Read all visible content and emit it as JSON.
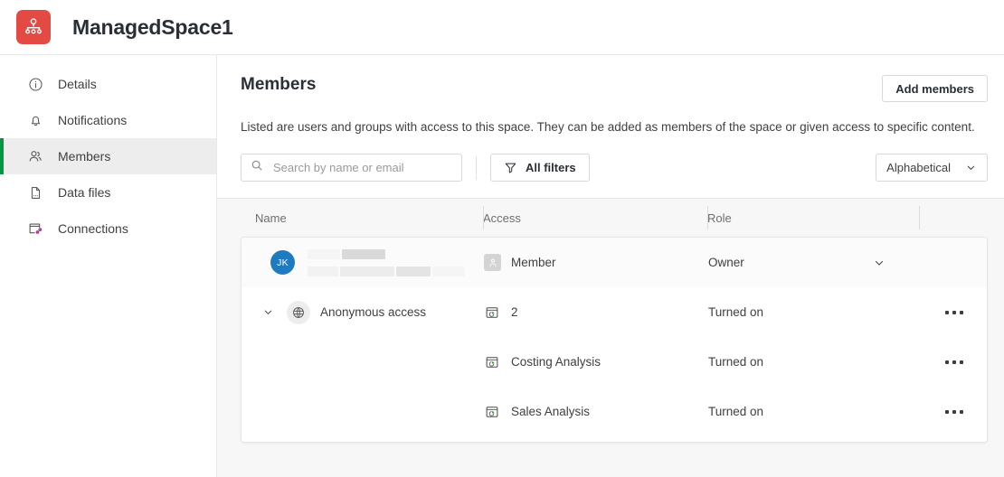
{
  "header": {
    "space_name": "ManagedSpace1",
    "space_icon": "shared-space-icon",
    "icon_color": "#e24a43"
  },
  "sidebar": {
    "items": [
      {
        "label": "Details",
        "icon": "info-circle-icon",
        "active": false
      },
      {
        "label": "Notifications",
        "icon": "bell-icon",
        "active": false
      },
      {
        "label": "Members",
        "icon": "people-icon",
        "active": true
      },
      {
        "label": "Data files",
        "icon": "file-icon",
        "active": false
      },
      {
        "label": "Connections",
        "icon": "connections-icon",
        "active": false
      }
    ],
    "active_accent": "#009845"
  },
  "main": {
    "title": "Members",
    "description": "Listed are users and groups with access to this space. They can be added as members of the space or given access to specific content.",
    "add_members_label": "Add members",
    "search": {
      "placeholder": "Search by name or email",
      "value": ""
    },
    "filters_label": "All filters",
    "sort": {
      "selected": "Alphabetical",
      "options": [
        "Alphabetical"
      ]
    },
    "table": {
      "columns": [
        "Name",
        "Access",
        "Role",
        ""
      ],
      "rows": [
        {
          "type": "user",
          "avatar_initials": "JK",
          "avatar_color": "#1f7bbf",
          "name_redacted": true,
          "access": "Member",
          "access_icon": "member-badge-icon",
          "role": "Owner",
          "role_control": "chevron-down-icon",
          "menu": false
        },
        {
          "type": "group",
          "expand_icon": "chevron-down-icon",
          "name": "Anonymous access",
          "name_icon": "globe-icon",
          "access": "2",
          "access_icon": "app-icon",
          "role": "Turned on",
          "menu": true
        },
        {
          "type": "app",
          "name": "",
          "access": "Costing Analysis",
          "access_icon": "app-icon",
          "role": "Turned on",
          "menu": true
        },
        {
          "type": "app",
          "name": "",
          "access": "Sales Analysis",
          "access_icon": "app-icon",
          "role": "Turned on",
          "menu": true
        }
      ]
    }
  }
}
